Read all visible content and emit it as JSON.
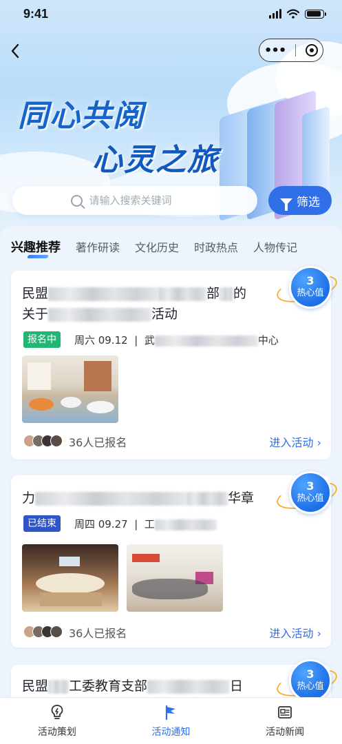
{
  "status_bar": {
    "time": "9:41",
    "battery_level": 0.9
  },
  "hero": {
    "title_line1": "同心共阅",
    "title_line2": "心灵之旅"
  },
  "search": {
    "placeholder": "请输入搜索关键词",
    "filter_label": "筛选"
  },
  "tabs": [
    {
      "label": "兴趣推荐",
      "active": true
    },
    {
      "label": "著作研读",
      "active": false
    },
    {
      "label": "文化历史",
      "active": false
    },
    {
      "label": "时政热点",
      "active": false
    },
    {
      "label": "人物传记",
      "active": false
    }
  ],
  "cards": [
    {
      "title_start": "民盟",
      "title_mid": "部",
      "title_end": "的",
      "title_line2_start": "关于",
      "title_line2_end": "活动",
      "status": "报名中",
      "status_color": "#22b573",
      "date": "周六 09.12",
      "location_start": "武",
      "location_end": "中心",
      "signup_count": "36人已报名",
      "enter_label": "进入活动",
      "hot_value": "3",
      "hot_label": "热心值"
    },
    {
      "title_start": "力",
      "title_end": "华章",
      "status": "已结束",
      "status_color": "#2f55c9",
      "date": "周四 09.27",
      "location_start": "工",
      "signup_count": "36人已报名",
      "enter_label": "进入活动",
      "hot_value": "3",
      "hot_label": "热心值"
    },
    {
      "title_start": "民盟",
      "title_mid": "工委教育支部",
      "title_end": "日",
      "hot_value": "3",
      "hot_label": "热心值"
    }
  ],
  "bottom_nav": [
    {
      "label": "活动策划",
      "icon": "lightbulb-icon",
      "active": false
    },
    {
      "label": "活动通知",
      "icon": "flag-icon",
      "active": true
    },
    {
      "label": "活动新闻",
      "icon": "newspaper-icon",
      "active": false
    }
  ],
  "colors": {
    "accent": "#2f6fe8",
    "title_blue": "#1663c9",
    "hot_ring": "#f2b233"
  }
}
